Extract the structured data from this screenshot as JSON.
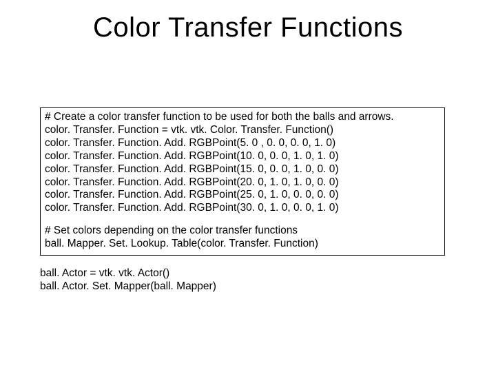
{
  "title": "Color Transfer Functions",
  "box": {
    "lines": [
      "# Create a color transfer function to be used for both the balls and arrows.",
      "color. Transfer. Function = vtk. vtk. Color. Transfer. Function()",
      "color. Transfer. Function. Add. RGBPoint(5. 0 , 0. 0, 0. 0, 1. 0)",
      "color. Transfer. Function. Add. RGBPoint(10. 0, 0. 0, 1. 0, 1. 0)",
      "color. Transfer. Function. Add. RGBPoint(15. 0, 0. 0, 1. 0, 0. 0)",
      "color. Transfer. Function. Add. RGBPoint(20. 0, 1. 0, 1. 0, 0. 0)",
      "color. Transfer. Function. Add. RGBPoint(25. 0, 1. 0, 0. 0, 0. 0)",
      "color. Transfer. Function. Add. RGBPoint(30. 0, 1. 0, 0. 0, 1. 0)"
    ],
    "comment2": "# Set colors depending on the color transfer functions",
    "mapline": "ball. Mapper. Set. Lookup. Table(color. Transfer. Function)"
  },
  "tail": {
    "l1": "ball. Actor = vtk. vtk. Actor()",
    "l2": "ball. Actor. Set. Mapper(ball. Mapper)"
  }
}
